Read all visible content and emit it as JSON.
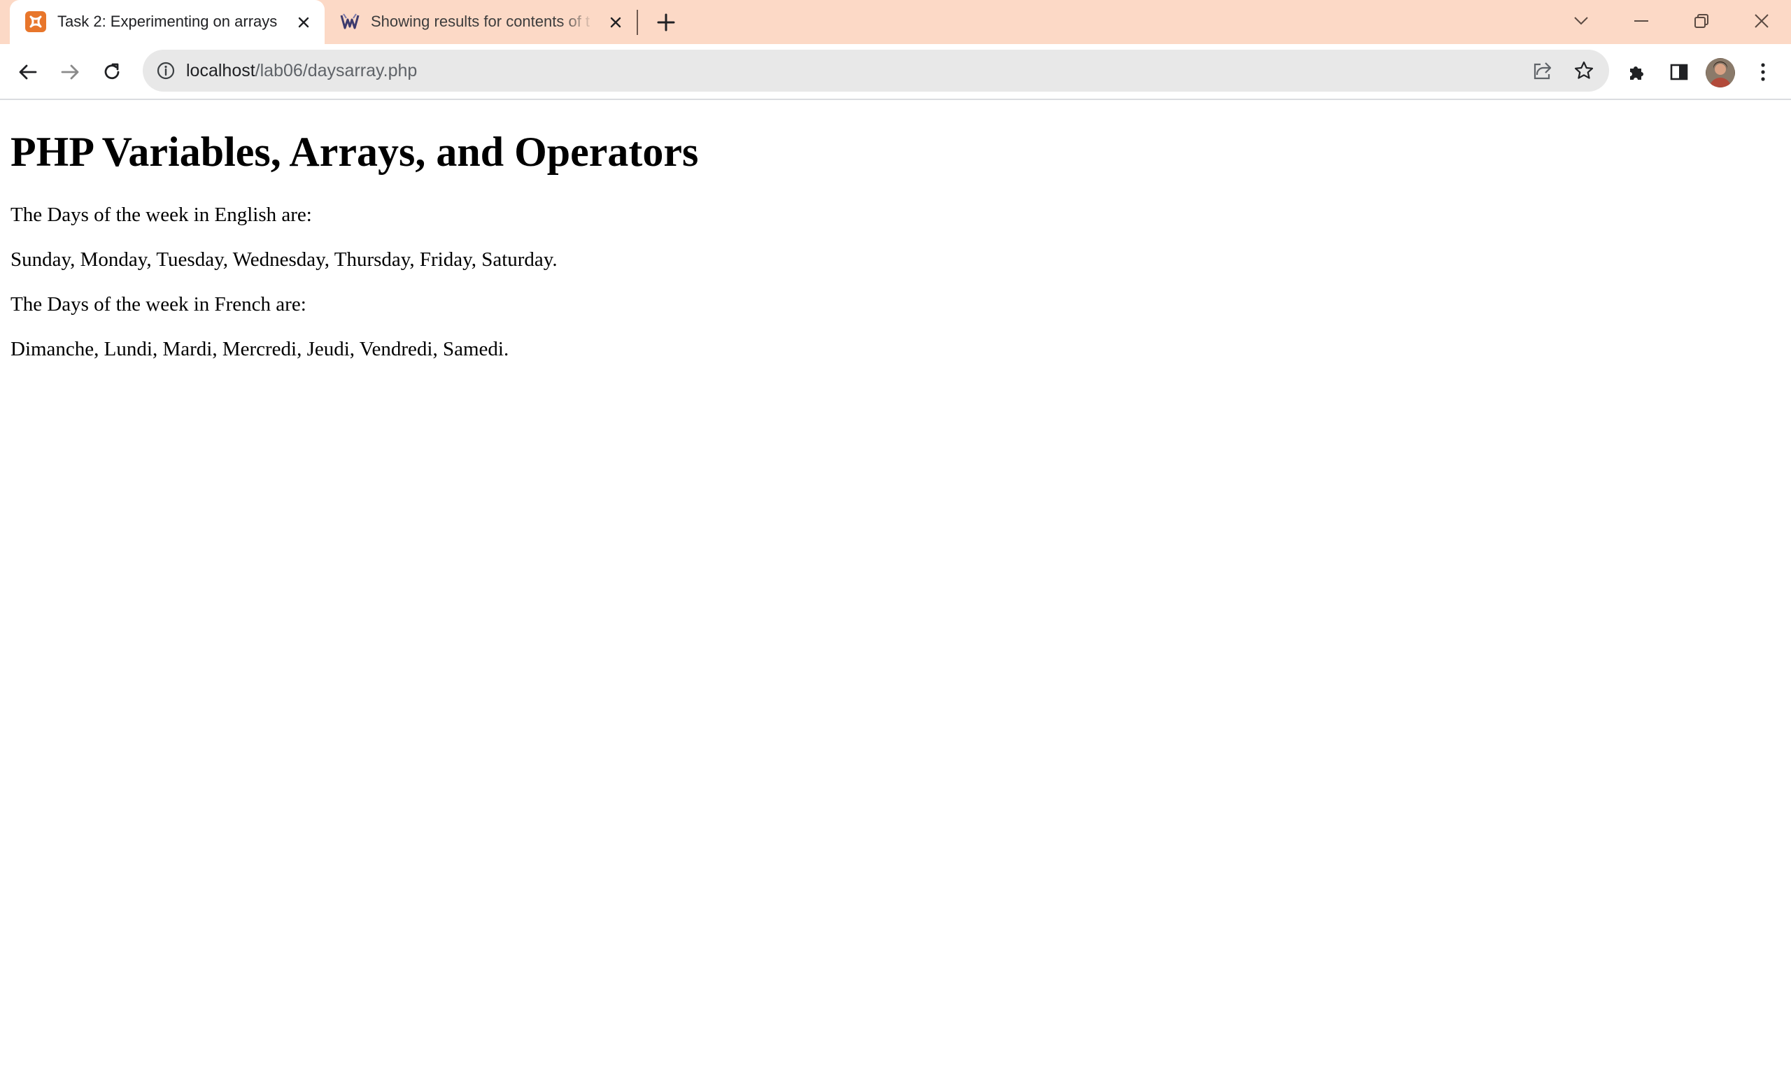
{
  "browser": {
    "tabs": [
      {
        "title": "Task 2: Experimenting on arrays",
        "favicon": "xampp-icon",
        "active": true
      },
      {
        "title": "Showing results for contents of t",
        "favicon": "wolfram-icon",
        "active": false
      }
    ],
    "address_bar": {
      "host": "localhost",
      "path": "/lab06/daysarray.php"
    },
    "colors": {
      "tabstrip": "#fcd9c6",
      "omnibox": "#e8e8e8"
    }
  },
  "page": {
    "heading": "PHP Variables, Arrays, and Operators",
    "english_intro": "The Days of the week in English are:",
    "english_days": "Sunday, Monday, Tuesday, Wednesday, Thursday, Friday, Saturday.",
    "french_intro": "The Days of the week in French are:",
    "french_days": "Dimanche, Lundi, Mardi, Mercredi, Jeudi, Vendredi, Samedi."
  }
}
